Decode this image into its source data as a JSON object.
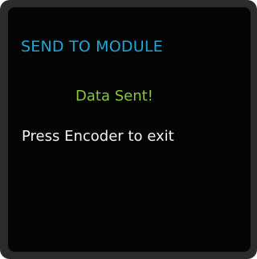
{
  "screen": {
    "title": "SEND TO MODULE",
    "status": "Data Sent!",
    "hint": "Press Encoder to exit"
  },
  "colors": {
    "bezel": "#2b2b2b",
    "background": "#050505",
    "title": "#1aa8d6",
    "status": "#86c83a",
    "hint": "#f2f2f2"
  }
}
